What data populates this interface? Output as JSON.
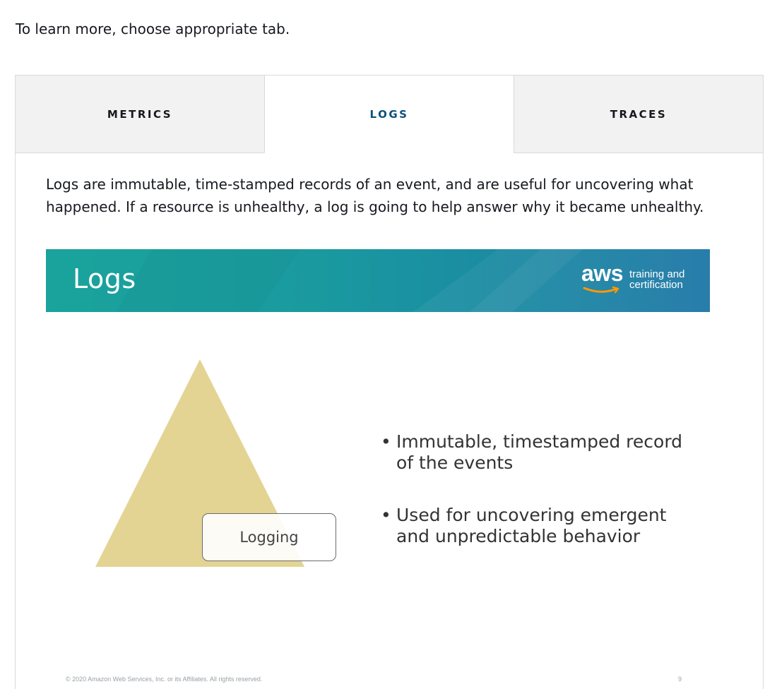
{
  "intro": "To learn more, choose appropriate tab.",
  "tabs": [
    {
      "label": "METRICS",
      "active": false
    },
    {
      "label": "LOGS",
      "active": true
    },
    {
      "label": "TRACES",
      "active": false
    }
  ],
  "panel": {
    "description": "Logs are immutable, time-stamped records of an event, and are useful for uncovering what happened. If a resource is unhealthy, a log is going to help answer why it became unhealthy.",
    "slide": {
      "title": "Logs",
      "logo": {
        "wordmark": "aws",
        "tagline": "training and\ncertification"
      },
      "diagram_label": "Logging",
      "bullets": [
        "Immutable, timestamped record of the events",
        "Used for uncovering emergent and unpredictable behavior"
      ],
      "copyright": "© 2020 Amazon Web Services, Inc. or its Affiliates. All rights reserved.",
      "page_number": "9"
    }
  },
  "colors": {
    "active_tab_text": "#0b4f7a",
    "banner_start": "#1aa39c",
    "banner_end": "#1d77a6",
    "pyramid_fill": "#e3d494",
    "aws_smile": "#f90"
  }
}
